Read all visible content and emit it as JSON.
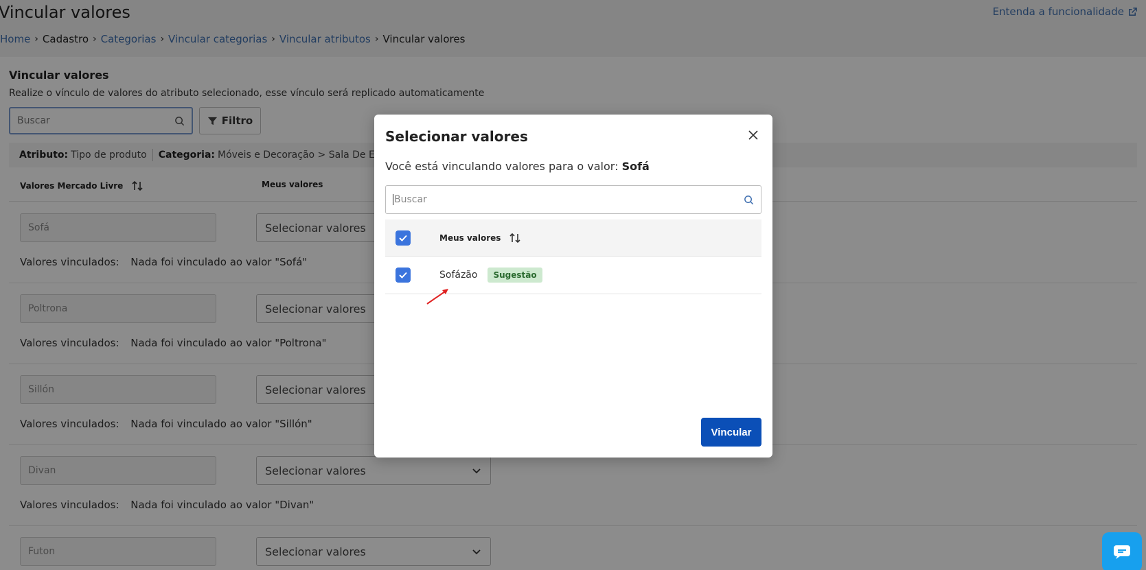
{
  "page": {
    "title": "Vincular valores",
    "help_link": "Entenda a funcionalidade"
  },
  "breadcrumb": {
    "home": "Home",
    "cadastro": "Cadastro",
    "categorias": "Categorias",
    "vincular_categorias": "Vincular categorias",
    "vincular_atributos": "Vincular atributos",
    "current": "Vincular valores"
  },
  "section": {
    "title": "Vincular valores",
    "description": "Realize o vínculo de valores do atributo selecionado, esse vínculo será replicado automaticamente",
    "search_placeholder": "Buscar",
    "filter_label": "Filtro"
  },
  "info_bar": {
    "atributo_label": "Atributo:",
    "atributo_value": "Tipo de produto",
    "categoria_label": "Categoria:",
    "categoria_value": "Móveis e Decoração > Sala De Esta..."
  },
  "table": {
    "col_ml": "Valores Mercado Livre",
    "col_meus": "Meus valores",
    "linked_label": "Valores vinculados:",
    "select_placeholder": "Selecionar valores",
    "rows": [
      {
        "value": "Sofá",
        "linked": "Nada foi vinculado ao valor \"Sofá\""
      },
      {
        "value": "Poltrona",
        "linked": "Nada foi vinculado ao valor \"Poltrona\""
      },
      {
        "value": "Sillón",
        "linked": "Nada foi vinculado ao valor \"Sillón\""
      },
      {
        "value": "Divan",
        "linked": "Nada foi vinculado ao valor \"Divan\""
      },
      {
        "value": "Futon",
        "linked": ""
      }
    ]
  },
  "modal": {
    "title": "Selecionar valores",
    "subtitle": "Você está vinculando valores para o valor:",
    "subtitle_value": "Sofá",
    "search_placeholder": "Buscar",
    "column_label": "Meus valores",
    "item_value": "Sofázão",
    "item_badge": "Sugestão",
    "submit_label": "Vincular"
  },
  "colors": {
    "primary": "#0b4fb7",
    "checkbox": "#3b74dd",
    "link": "#3f6fb0",
    "badge_bg": "#cde9cf",
    "chat": "#17a0ee"
  }
}
